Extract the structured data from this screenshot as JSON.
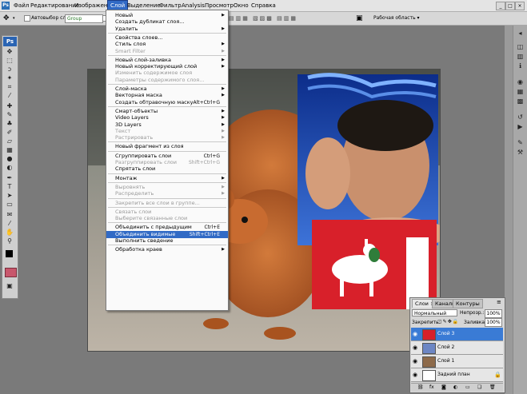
{
  "menubar": {
    "app_logo": "Ps",
    "items": [
      "Файл",
      "Редактирование",
      "Изображение",
      "Слой",
      "Выделение",
      "Фильтр",
      "Analysis",
      "Просмотр",
      "Окно",
      "Справка"
    ],
    "active_item": "Слой"
  },
  "options": {
    "autoselect_label": "Автовыбор слоя",
    "autoselect_value": "Group",
    "workspace_label": "Рабочая область ▾"
  },
  "toolbox": {
    "logo": "Ps"
  },
  "layer_menu": {
    "items": [
      {
        "label": "Новый",
        "shortcut": "",
        "submenu": true,
        "disabled": false
      },
      {
        "label": "Создать дубликат слоя...",
        "shortcut": "",
        "submenu": false,
        "disabled": false
      },
      {
        "label": "Удалить",
        "shortcut": "",
        "submenu": true,
        "disabled": false
      },
      {
        "sep": true
      },
      {
        "label": "Свойства слоев...",
        "shortcut": "",
        "submenu": false,
        "disabled": false
      },
      {
        "label": "Стиль слоя",
        "shortcut": "",
        "submenu": true,
        "disabled": false
      },
      {
        "label": "Smart Filter",
        "shortcut": "",
        "submenu": true,
        "disabled": true
      },
      {
        "sep": true
      },
      {
        "label": "Новый слой-заливка",
        "shortcut": "",
        "submenu": true,
        "disabled": false
      },
      {
        "label": "Новый корректирующий слой",
        "shortcut": "",
        "submenu": true,
        "disabled": false
      },
      {
        "label": "Изменить содержимое слоя",
        "shortcut": "",
        "submenu": false,
        "disabled": true
      },
      {
        "label": "Параметры содержимого слоя...",
        "shortcut": "",
        "submenu": false,
        "disabled": true
      },
      {
        "sep": true
      },
      {
        "label": "Слой-маска",
        "shortcut": "",
        "submenu": true,
        "disabled": false
      },
      {
        "label": "Векторная маска",
        "shortcut": "",
        "submenu": true,
        "disabled": false
      },
      {
        "label": "Создать обтравочную маску",
        "shortcut": "Alt+Ctrl+G",
        "submenu": false,
        "disabled": false
      },
      {
        "sep": true
      },
      {
        "label": "Смарт-объекты",
        "shortcut": "",
        "submenu": true,
        "disabled": false
      },
      {
        "label": "Video Layers",
        "shortcut": "",
        "submenu": true,
        "disabled": false
      },
      {
        "label": "3D Layers",
        "shortcut": "",
        "submenu": true,
        "disabled": false
      },
      {
        "label": "Текст",
        "shortcut": "",
        "submenu": true,
        "disabled": true
      },
      {
        "label": "Растрировать",
        "shortcut": "",
        "submenu": true,
        "disabled": true
      },
      {
        "sep": true
      },
      {
        "label": "Новый фрагмент из слоя",
        "shortcut": "",
        "submenu": false,
        "disabled": false
      },
      {
        "sep": true
      },
      {
        "label": "Сгруппировать слои",
        "shortcut": "Ctrl+G",
        "submenu": false,
        "disabled": false
      },
      {
        "label": "Разгруппировать слои",
        "shortcut": "Shift+Ctrl+G",
        "submenu": false,
        "disabled": true
      },
      {
        "label": "Спрятать слои",
        "shortcut": "",
        "submenu": false,
        "disabled": false
      },
      {
        "sep": true
      },
      {
        "label": "Монтаж",
        "shortcut": "",
        "submenu": true,
        "disabled": false
      },
      {
        "sep": true
      },
      {
        "label": "Выровнять",
        "shortcut": "",
        "submenu": true,
        "disabled": true
      },
      {
        "label": "Распределить",
        "shortcut": "",
        "submenu": true,
        "disabled": true
      },
      {
        "sep": true
      },
      {
        "label": "Закрепить все слои в группе...",
        "shortcut": "",
        "submenu": false,
        "disabled": true
      },
      {
        "sep": true
      },
      {
        "label": "Связать слои",
        "shortcut": "",
        "submenu": false,
        "disabled": true
      },
      {
        "label": "Выберите связанные слои",
        "shortcut": "",
        "submenu": false,
        "disabled": true
      },
      {
        "sep": true
      },
      {
        "label": "Объединить с предыдущим",
        "shortcut": "Ctrl+E",
        "submenu": false,
        "disabled": false
      },
      {
        "label": "Объединить видимые",
        "shortcut": "Shift+Ctrl+E",
        "submenu": false,
        "disabled": false,
        "highlighted": true
      },
      {
        "label": "Выполнить сведение",
        "shortcut": "",
        "submenu": false,
        "disabled": false
      },
      {
        "sep": true
      },
      {
        "label": "Обработка краев",
        "shortcut": "",
        "submenu": true,
        "disabled": false
      }
    ]
  },
  "layers_panel": {
    "tabs": [
      "Слои ×",
      "Каналы",
      "Контуры"
    ],
    "blend_mode": "Нормальный",
    "opacity_label": "Непрозр.:",
    "opacity_value": "100%",
    "lock_label": "Закрепить:",
    "fill_label": "Заливка:",
    "fill_value": "100%",
    "layers": [
      {
        "name": "Слой 3",
        "selected": true
      },
      {
        "name": "Слой 2",
        "selected": false
      },
      {
        "name": "Слой 1",
        "selected": false
      },
      {
        "name": "Задний план",
        "selected": false
      }
    ],
    "footer_icons": [
      "link-icon",
      "fx-icon",
      "mask-icon",
      "adjustment-icon",
      "folder-icon",
      "new-layer-icon",
      "trash-icon"
    ]
  }
}
